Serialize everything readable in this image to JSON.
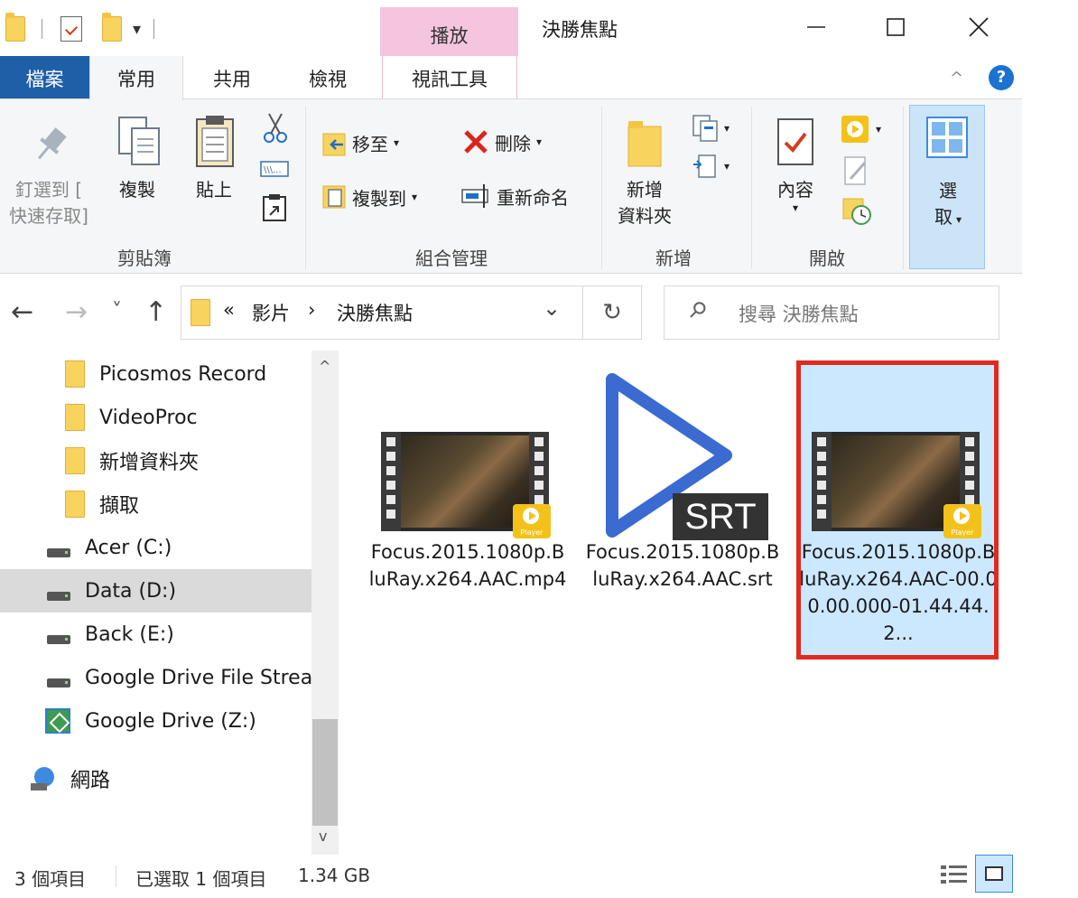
{
  "titlebar": {
    "context_tab": "播放",
    "window_title": "決勝焦點",
    "minimize_glyph": "—",
    "maximize_glyph": "☐",
    "close_glyph": "✕",
    "dropdown_glyph": "▾"
  },
  "tabs": {
    "file": "檔案",
    "home": "常用",
    "share": "共用",
    "view": "檢視",
    "video_tools": "視訊工具",
    "collapse_glyph": "^",
    "help_glyph": "?"
  },
  "ribbon": {
    "clipboard": {
      "group_label": "剪貼簿",
      "pin_line1": "釘選到 [",
      "pin_line2": "快速存取]",
      "copy": "複製",
      "paste": "貼上"
    },
    "organize": {
      "group_label": "組合管理",
      "move_to": "移至",
      "delete": "刪除",
      "copy_to": "複製到",
      "rename": "重新命名"
    },
    "new": {
      "group_label": "新增",
      "new_folder_line1": "新增",
      "new_folder_line2": "資料夾"
    },
    "open": {
      "group_label": "開啟",
      "properties": "內容"
    },
    "select": {
      "line1": "選",
      "line2": "取"
    },
    "dropdown_glyph": "▾"
  },
  "address": {
    "back_glyph": "←",
    "forward_glyph": "→",
    "recent_glyph": "˅",
    "up_glyph": "↑",
    "overflow": "«",
    "crumb_sep": "›",
    "crumb1": "影片",
    "crumb2": "決勝焦點",
    "dropdown_glyph": "⌄",
    "refresh_glyph": "↻",
    "search_placeholder": "搜尋 決勝焦點",
    "search_glyph": "⚲"
  },
  "navpane": {
    "items": [
      {
        "label": "Picosmos Record",
        "icon": "folder-icon"
      },
      {
        "label": "VideoProc",
        "icon": "folder-icon"
      },
      {
        "label": "新增資料夾",
        "icon": "folder-icon"
      },
      {
        "label": "擷取",
        "icon": "folder-icon"
      },
      {
        "label": "Acer (C:)",
        "icon": "drive-icon"
      },
      {
        "label": "Data (D:)",
        "icon": "drive-icon",
        "selected": true
      },
      {
        "label": "Back (E:)",
        "icon": "drive-icon"
      },
      {
        "label": "Google Drive File Stream",
        "icon": "drive-icon"
      },
      {
        "label": "Google Drive (Z:)",
        "icon": "google-drive-icon"
      },
      {
        "label": "網路",
        "icon": "network-icon"
      }
    ],
    "scroll_up_glyph": "^",
    "scroll_down_glyph": "v"
  },
  "files": [
    {
      "name": "Focus.2015.1080p.BluRay.x264.AAC.mp4",
      "icon": "video-file-icon",
      "badge": "Player"
    },
    {
      "name": "Focus.2015.1080p.BluRay.x264.AAC.srt",
      "icon": "srt-file-icon",
      "badge": "SRT"
    },
    {
      "name": "Focus.2015.1080p.BluRay.x264.AAC-00.00.00.000-01.44.44.2...",
      "icon": "video-file-icon",
      "badge": "Player",
      "selected": true
    }
  ],
  "status": {
    "item_count": "3 個項目",
    "selection": "已選取 1 個項目",
    "size": "1.34 GB"
  },
  "colors": {
    "accent": "#1e5fa8",
    "selection_bg": "#cce8ff",
    "highlight_box": "#e02a1f",
    "context_tab": "#f5c5de"
  }
}
